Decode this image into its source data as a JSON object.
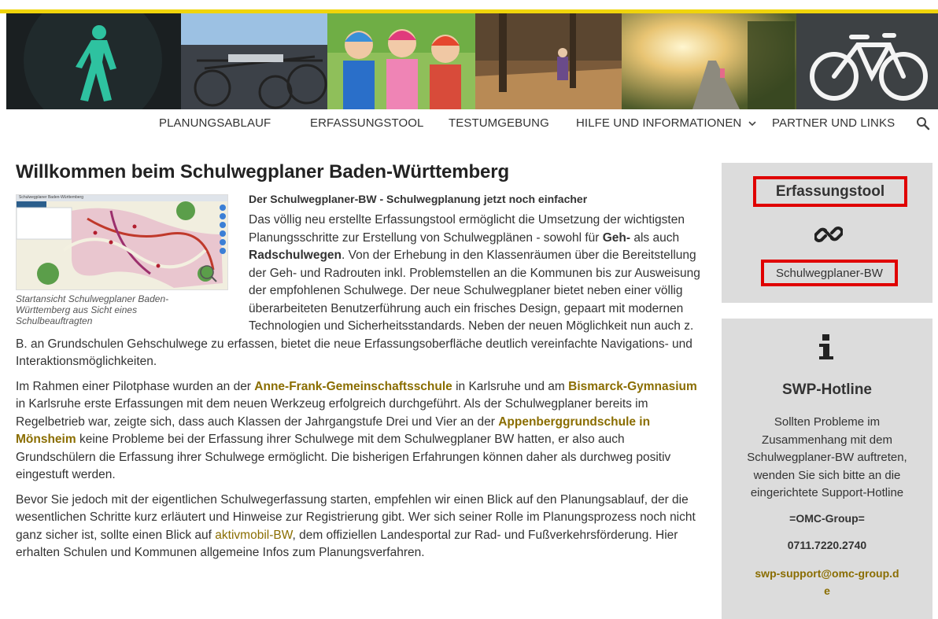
{
  "nav": {
    "items": [
      "PLANUNGSABLAUF",
      "ERFASSUNGSTOOL",
      "TESTUMGEBUNG",
      "HILFE UND INFORMATIONEN",
      "PARTNER UND LINKS"
    ],
    "dropdown_icon": "chevron-down-icon",
    "search_icon": "search-icon"
  },
  "main": {
    "title": "Willkommen beim Schulwegplaner Baden-Württemberg",
    "figure_caption": "Startansicht Schulwegplaner Baden-Württemberg aus Sicht eines Schulbeauftragten",
    "map_header": "Schulwegplaner Baden-Württemberg",
    "lead": "Der Schulwegplaner-BW - Schulwegplanung jetzt noch einfacher",
    "p1_a": "Das völlig neu erstellte Erfassungstool ermöglicht die Umsetzung der wichtigsten Planungsschritte zur Erstellung von Schulwegplänen - sowohl für ",
    "p1_b1": "Geh-",
    "p1_c": " als auch ",
    "p1_b2": "Radschulwegen",
    "p1_d": ". Von der Erhebung in den Klassenräumen über die Bereitstellung der Geh- und Radrouten inkl. Problemstellen an die Kommunen bis zur Ausweisung der empfohlenen Schulwege. Der neue Schulwegplaner bietet neben einer völlig überarbeiteten Benutzerführung auch ein frisches Design, gepaart mit modernen Technologien und Sicherheitsstandards. Neben der neuen Möglichkeit nun auch z. B. an Grundschulen Gehschulwege zu erfassen, bietet die neue Erfassungsoberfläche deutlich vereinfachte Navigations- und Interaktionsmöglichkeiten.",
    "p2_a": "Im Rahmen einer Pilotphase wurden an der ",
    "p2_link1": "Anne-Frank-Gemeinschaftsschule",
    "p2_b": " in Karlsruhe und am ",
    "p2_link2": "Bismarck-Gymnasium",
    "p2_c": " in Karlsruhe erste Erfassungen mit dem neuen Werkzeug erfolgreich durchgeführt. Als der Schulwegplaner bereits im Regelbetrieb war, zeigte sich, dass auch Klassen der Jahrgangstufe Drei und Vier an der ",
    "p2_link3": "Appenberggrundschule in Mönsheim",
    "p2_d": " keine Probleme bei der Erfassung ihrer Schulwege mit dem Schulwegplaner BW hatten, er also auch Grundschülern die Erfassung ihrer Schulwege ermöglicht. Die bisherigen Erfahrungen können daher als durchweg positiv eingestuft werden.",
    "p3_a": "Bevor Sie jedoch mit der eigentlichen Schulwegerfassung starten, empfehlen wir einen Blick auf den Planungsablauf, der die wesentlichen Schritte kurz erläutert und Hinweise zur Registrierung gibt. Wer sich seiner Rolle im Planungsprozess noch nicht ganz sicher ist, sollte einen Blick auf ",
    "p3_link": "aktivmobil-BW",
    "p3_b": ", dem offiziellen Landesportal zur Rad- und Fußverkehrsförderung. Hier erhalten Schulen und Kommunen allgemeine Infos zum Planungsverfahren."
  },
  "sidebar": {
    "tool_title": "Erfassungstool",
    "tool_icon": "link-icon",
    "tool_link": "Schulwegplaner-BW",
    "hotline_icon": "info-icon",
    "hotline_title": "SWP-Hotline",
    "hotline_text": "Sollten Probleme im Zusammenhang mit dem Schulwegplaner-BW auftreten, wenden Sie sich bitte an die eingerichtete Support-Hotline",
    "hotline_group": "=OMC-Group=",
    "hotline_phone": "0711.7220.2740",
    "hotline_email": "swp-support@omc-group.de"
  },
  "colors": {
    "accent_yellow": "#f0d40b",
    "link_gold": "#8a6d00",
    "highlight_red": "#e00000",
    "sidebar_bg": "#dcdcdc"
  }
}
